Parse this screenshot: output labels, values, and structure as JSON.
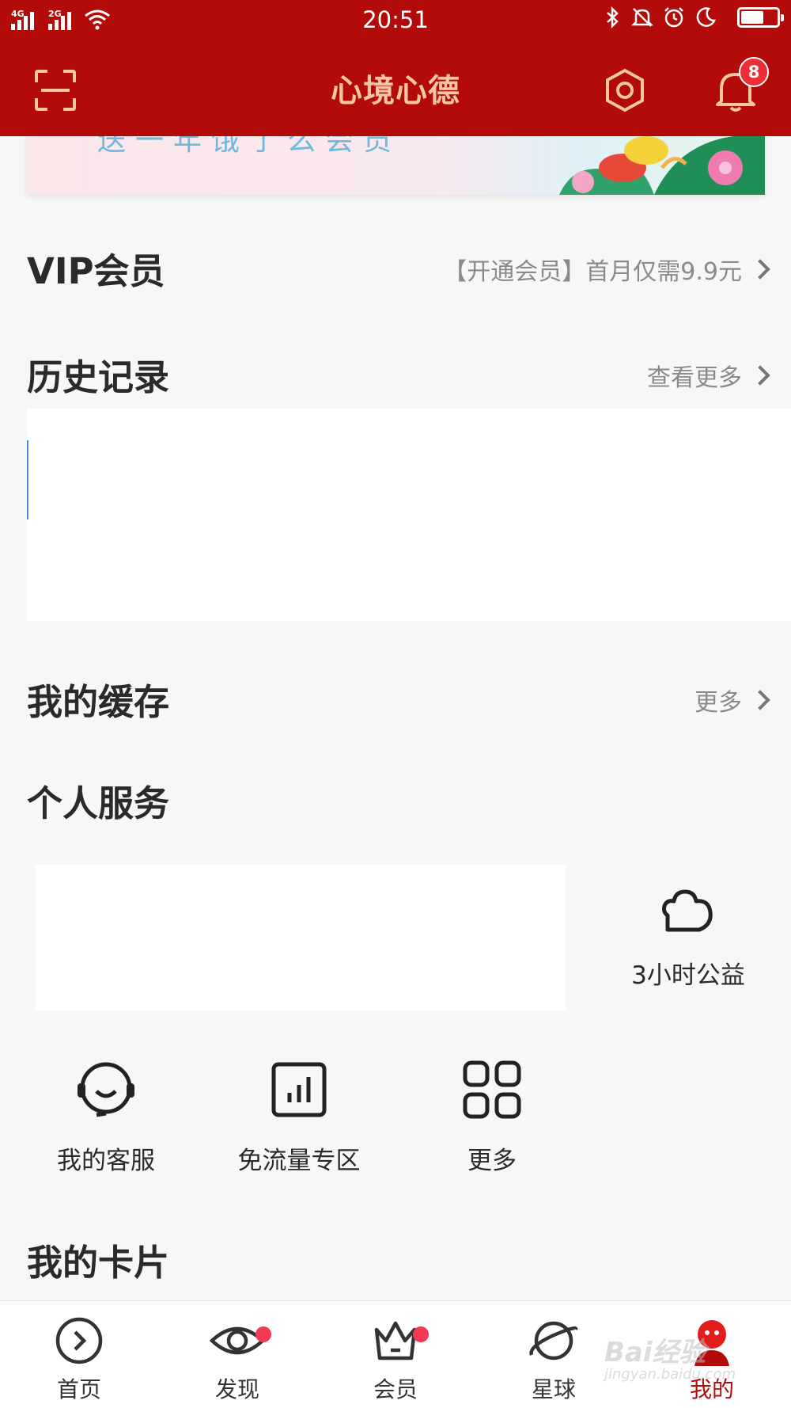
{
  "status_bar": {
    "network_1": "4G",
    "network_2": "2G",
    "time": "20:51"
  },
  "header": {
    "title": "心境心德",
    "notification_count": "8",
    "icons": [
      "scan-icon",
      "settings-icon",
      "bell-icon"
    ],
    "colors": {
      "background": "#b30a0a",
      "title": "#f3c6a3"
    }
  },
  "banner": {
    "partial_text": "送一年饿了么会员"
  },
  "vip": {
    "title": "VIP会员",
    "promo": "【开通会员】首月仅需9.9元"
  },
  "history": {
    "title": "历史记录",
    "more": "查看更多"
  },
  "cache": {
    "title": "我的缓存",
    "more": "更多"
  },
  "services": {
    "title": "个人服务",
    "items": [
      {
        "label": "3小时公益",
        "icon": "cloud-heart-icon"
      },
      {
        "label": "我的客服",
        "icon": "headset-icon"
      },
      {
        "label": "免流量专区",
        "icon": "bar-chart-icon"
      },
      {
        "label": "更多",
        "icon": "grid-icon"
      }
    ]
  },
  "cards": {
    "title": "我的卡片"
  },
  "bottom_nav": {
    "items": [
      {
        "label": "首页",
        "icon": "play-circle-icon",
        "dot": false
      },
      {
        "label": "发现",
        "icon": "eye-icon",
        "dot": true
      },
      {
        "label": "会员",
        "icon": "crown-icon",
        "dot": true
      },
      {
        "label": "星球",
        "icon": "planet-icon",
        "dot": false
      },
      {
        "label": "我的",
        "icon": "avatar-icon",
        "dot": false,
        "active": true
      }
    ],
    "active_color": "#b30a0a",
    "dot_color": "#f23a55"
  },
  "watermark": {
    "text": "Bai经验",
    "subtext": "jingyan.baidu.com"
  }
}
